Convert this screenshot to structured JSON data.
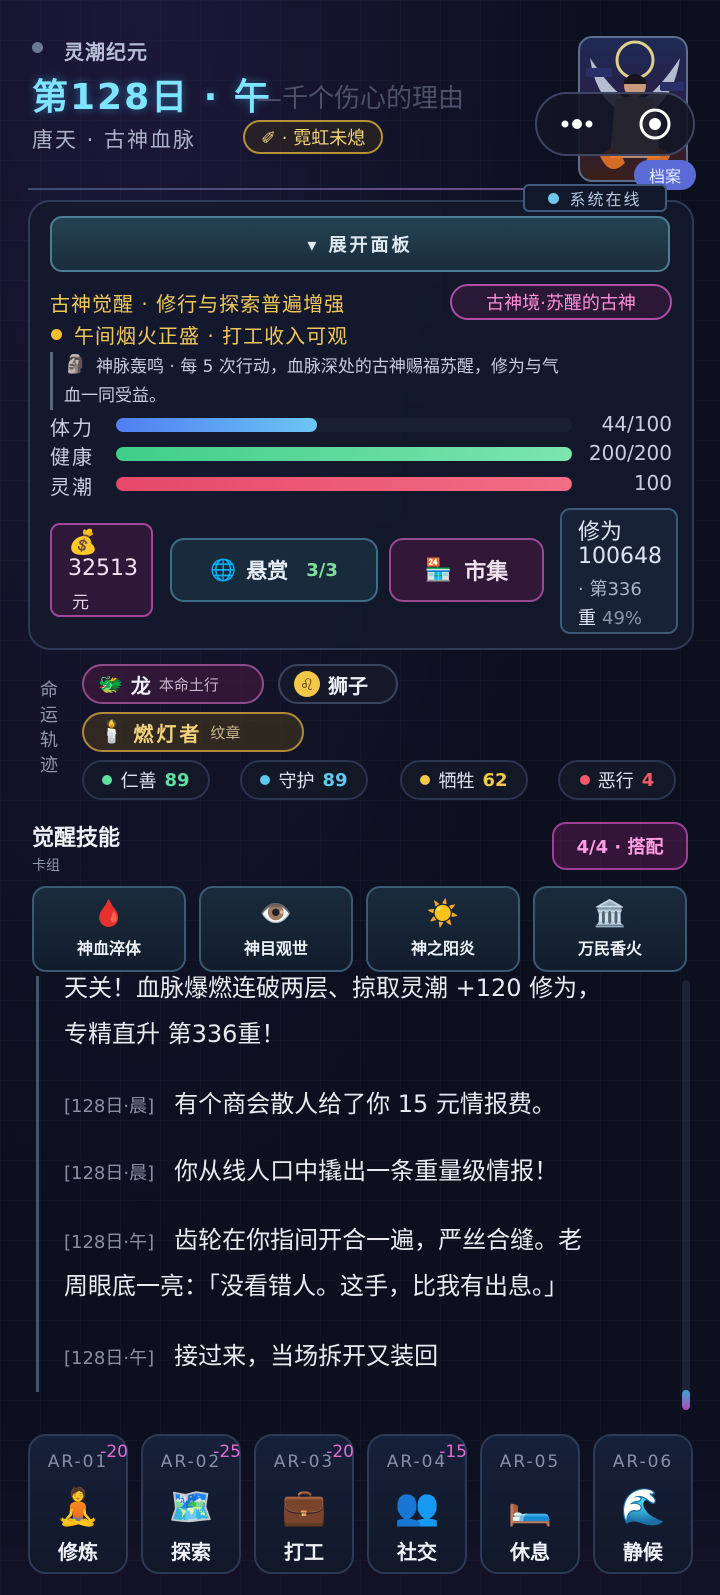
{
  "header": {
    "era": "灵潮纪元",
    "day_title": "第128日 · 午",
    "marquee": "—千个伤心的理由",
    "character": "唐天 · 古神血脉",
    "title_badge": "✐ · 霓虹未熄",
    "archive_label": "档案",
    "system_status": "系统在线"
  },
  "panel": {
    "expand_label": "▾ 展开面板",
    "buff_primary": "古神觉醒 · 修行与探索普遍增强",
    "realm_badge": "古神境·苏醒的古神",
    "buff_secondary": "午间烟火正盛 · 打工收入可观",
    "note_icon": "🗿",
    "note_line1": "神脉轰鸣 · 每 5 次行动，血脉深处的古神赐福苏醒，修为与气",
    "note_line2": "血一同受益。"
  },
  "stats": [
    {
      "label": "体力",
      "value_text": "44/100",
      "fill": 0.44,
      "color_start": "#4f7ef2",
      "color_end": "#6cc6f5"
    },
    {
      "label": "健康",
      "value_text": "200/200",
      "fill": 1.0,
      "color_start": "#3fce89",
      "color_end": "#7de5b0"
    },
    {
      "label": "灵潮",
      "value_text": "100",
      "fill": 1.0,
      "color_start": "#e64768",
      "color_end": "#f26e85"
    }
  ],
  "money": {
    "icon": "💰",
    "amount": "32513",
    "unit": "元"
  },
  "bounty": {
    "icon": "🌐",
    "label": "悬赏",
    "count": "3/3"
  },
  "market": {
    "icon": "🏪",
    "label": "市集"
  },
  "cultivation": {
    "line1": "修为",
    "value": "100648",
    "tier": "· 第336",
    "tier_unit": "重",
    "progress": "49%"
  },
  "fate": {
    "label": "命运轨迹",
    "zodiac": {
      "icon": "🐲",
      "name": "龙",
      "sub": "本命土行"
    },
    "sign": {
      "icon": "♌",
      "name": "狮子"
    },
    "medal": {
      "icon": "🕯️",
      "name": "燃灯者",
      "sub": "纹章"
    },
    "virtues": [
      {
        "name": "仁善",
        "value": "89",
        "color": "#5ee0a0"
      },
      {
        "name": "守护",
        "value": "89",
        "color": "#63c8f0"
      },
      {
        "name": "牺牲",
        "value": "62",
        "color": "#f2c84a"
      },
      {
        "name": "恶行",
        "value": "4",
        "color": "#f05a6a"
      }
    ]
  },
  "skills": {
    "title": "觉醒技能",
    "subtitle": "卡组",
    "loadout": "4/4 · 搭配",
    "cards": [
      {
        "icon": "🩸",
        "name": "神血淬体"
      },
      {
        "icon": "👁️",
        "name": "神目观世"
      },
      {
        "icon": "☀️",
        "name": "神之阳炎"
      },
      {
        "icon": "🏛️",
        "name": "万民香火"
      }
    ]
  },
  "log": {
    "lead_line1": "天关！血脉爆燃连破两层、掠取灵潮 +120 修为，",
    "lead_line2": "专精直升 第336重！",
    "entries": [
      {
        "ts": "[128日·晨]",
        "text": "有个商会散人给了你 15 元情报费。",
        "cont": ""
      },
      {
        "ts": "[128日·晨]",
        "text": "你从线人口中撬出一条重量级情报！",
        "cont": ""
      },
      {
        "ts": "[128日·午]",
        "text": "齿轮在你指间开合一遍，严丝合缝。老",
        "cont": "周眼底一亮：「没看错人。这手，比我有出息。」"
      },
      {
        "ts": "[128日·午]",
        "text": "接过来，当场拆开又装回",
        "cont": ""
      }
    ]
  },
  "actions": [
    {
      "code": "AR-01",
      "cost": "-20",
      "icon": "🧘",
      "label": "修炼"
    },
    {
      "code": "AR-02",
      "cost": "-25",
      "icon": "🗺️",
      "label": "探索"
    },
    {
      "code": "AR-03",
      "cost": "-20",
      "icon": "💼",
      "label": "打工"
    },
    {
      "code": "AR-04",
      "cost": "-15",
      "icon": "👥",
      "label": "社交"
    },
    {
      "code": "AR-05",
      "cost": "",
      "icon": "🛏️",
      "label": "休息"
    },
    {
      "code": "AR-06",
      "cost": "",
      "icon": "🌊",
      "label": "静候"
    }
  ]
}
